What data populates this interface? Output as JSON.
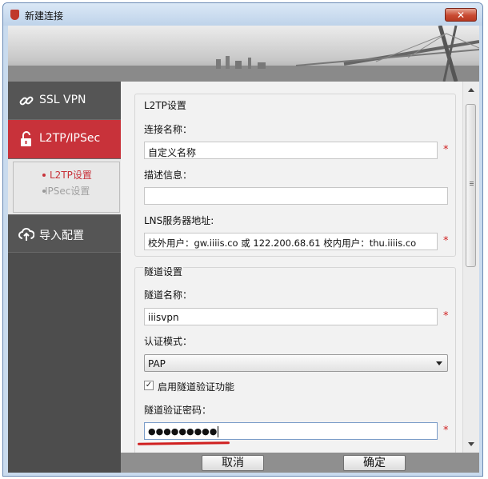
{
  "window": {
    "title": "新建连接",
    "close_glyph": "✕"
  },
  "sidebar": {
    "items": [
      {
        "label": "SSL VPN",
        "icon": "link-icon",
        "active": false
      },
      {
        "label": "L2TP/IPSec",
        "icon": "unlock-icon",
        "active": true
      },
      {
        "label": "导入配置",
        "icon": "cloud-upload-icon",
        "active": false
      }
    ],
    "subitems": [
      {
        "label": "L2TP设置",
        "active": true
      },
      {
        "label": "IPSec设置",
        "active": false
      }
    ]
  },
  "l2tp": {
    "group_label": "L2TP设置",
    "name_label": "连接名称：",
    "name_value": "自定义名称",
    "desc_label": "描述信息：",
    "desc_value": "",
    "lns_label": "LNS服务器地址:",
    "lns_value": "校外用户：gw.iiiis.co 或 122.200.68.61    校内用户：thu.iiiis.co"
  },
  "tunnel": {
    "group_label": "隧道设置",
    "name_label": "隧道名称：",
    "name_value": "iiisvpn",
    "auth_label": "认证模式：",
    "auth_value": "PAP",
    "enable_label": "启用隧道验证功能",
    "enable_checked": true,
    "pwd_label": "隧道验证密码：",
    "pwd_value": "●●●●●●●●●"
  },
  "required_mark": "*",
  "buttons": {
    "cancel": "取消",
    "ok": "确定"
  },
  "colors": {
    "accent": "#c8323a",
    "sidebar": "#4d4d4d",
    "titlebar": "#c9dbee"
  }
}
